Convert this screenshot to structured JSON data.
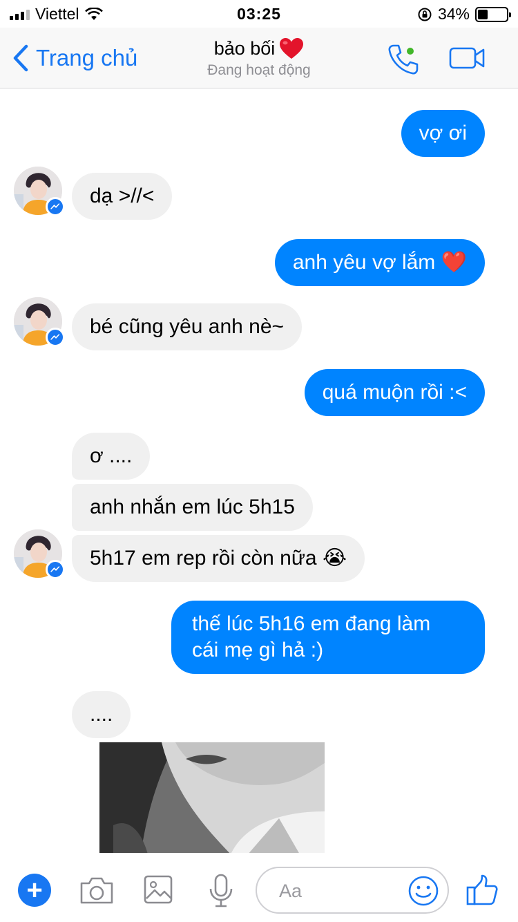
{
  "status_bar": {
    "carrier": "Viettel",
    "time": "03:25",
    "battery_percent": "34%",
    "battery_level": 0.34
  },
  "header": {
    "back_label": "Trang chủ",
    "title": "bảo bối",
    "title_emoji": "heart-icon",
    "subtitle": "Đang hoạt động",
    "online_dot_color": "#42b72a",
    "accent": "#1877f2"
  },
  "messages": [
    {
      "sender": "me",
      "text": "vợ ơi"
    },
    {
      "sender": "them",
      "text": "dạ >//<"
    },
    {
      "sender": "me",
      "text": "anh yêu vợ lắm ❤️"
    },
    {
      "sender": "them",
      "text": "bé cũng yêu anh nè~"
    },
    {
      "sender": "me",
      "text": "quá muộn rồi :<"
    },
    {
      "sender": "them",
      "text": "ơ ...."
    },
    {
      "sender": "them",
      "text": "anh nhắn em lúc 5h15"
    },
    {
      "sender": "them",
      "text": "5h17 em rep rồi còn nữa 😭"
    },
    {
      "sender": "me",
      "text_line1": "thế lúc 5h16 em đang làm",
      "text_line2": "cái mẹ gì hả :)"
    },
    {
      "sender": "them",
      "text": "...."
    }
  ],
  "colors": {
    "outgoing_bubble": "#0084ff",
    "incoming_bubble": "#f0f0f0"
  },
  "composer": {
    "placeholder": "Aa",
    "icons": [
      "plus-icon",
      "camera-icon",
      "photo-icon",
      "microphone-icon",
      "emoji-icon",
      "like-icon"
    ]
  }
}
